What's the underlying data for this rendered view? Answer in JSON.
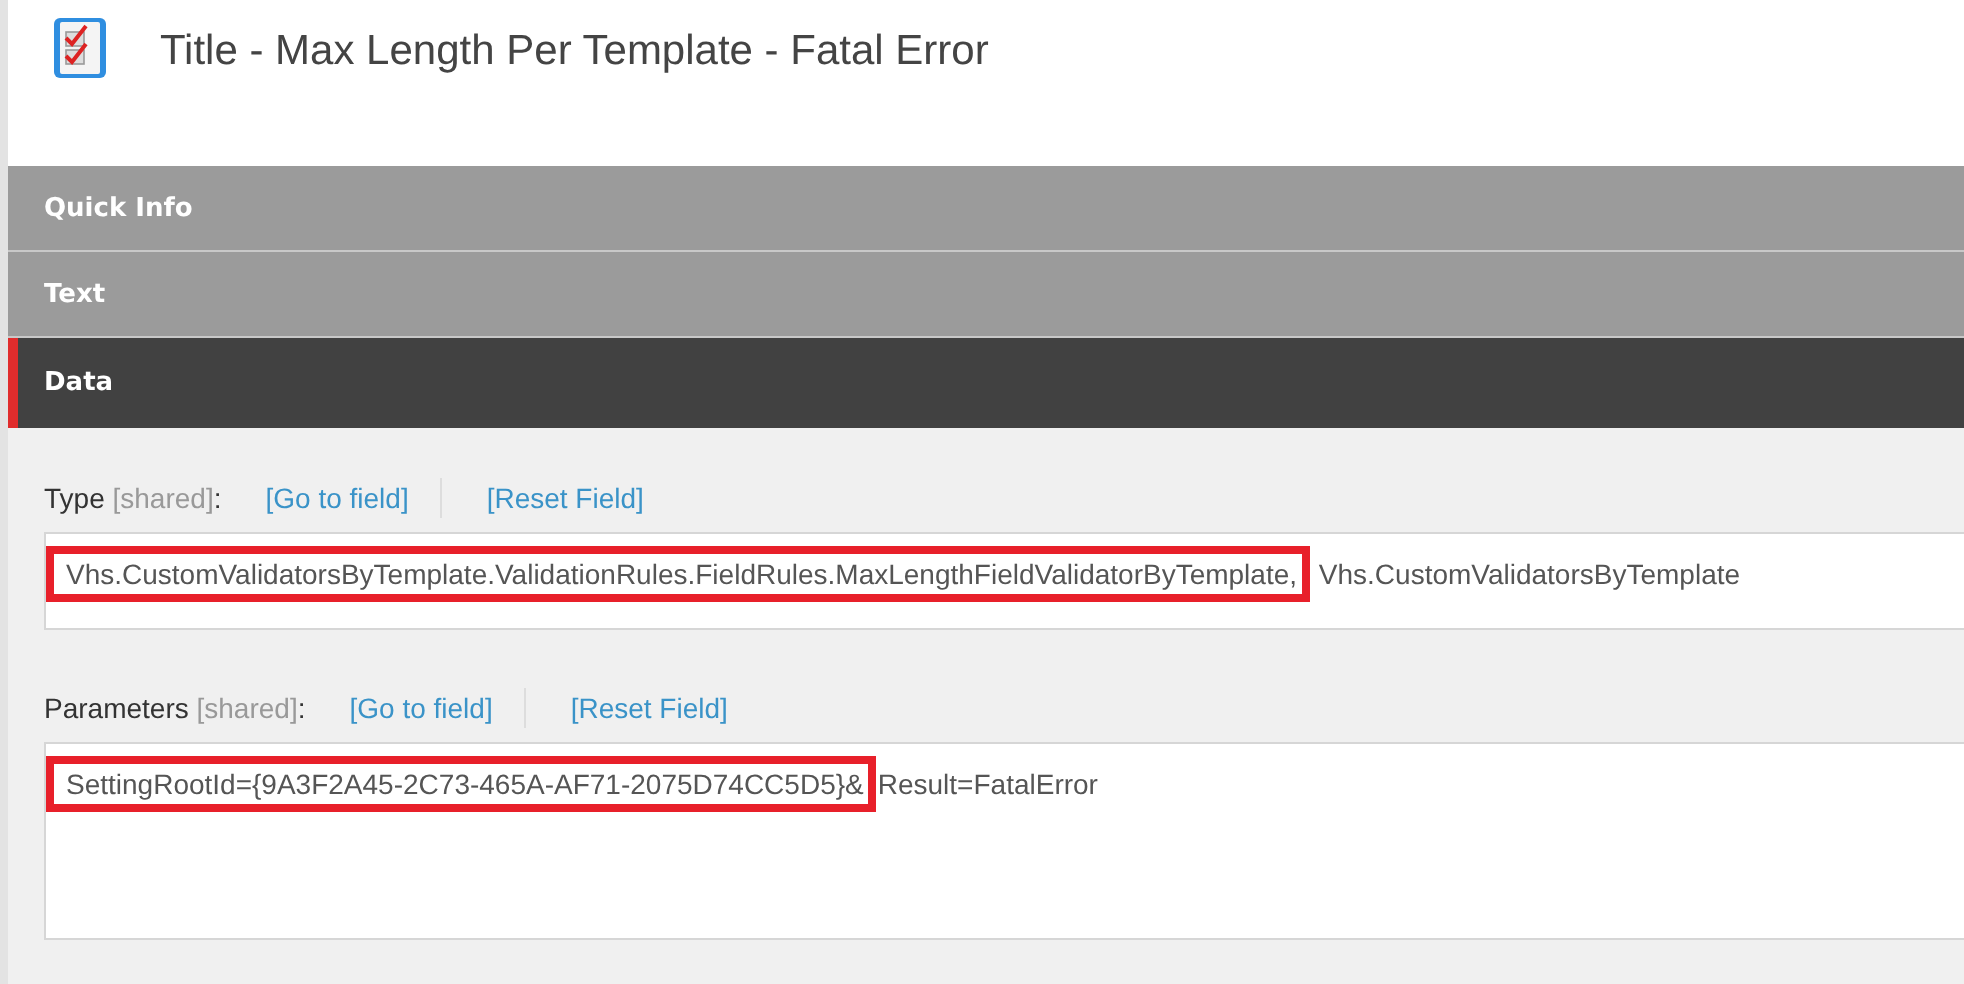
{
  "header": {
    "title": "Title - Max Length Per Template - Fatal Error"
  },
  "sections": [
    {
      "label": "Quick Info",
      "expanded": false
    },
    {
      "label": "Text",
      "expanded": false
    },
    {
      "label": "Data",
      "expanded": true
    }
  ],
  "fields": [
    {
      "kind": "line",
      "label": "Type",
      "shared": "[shared]",
      "colon": ":",
      "links": [
        "[Go to field]",
        "[Reset Field]"
      ],
      "value": {
        "highlighted": "Vhs.CustomValidatorsByTemplate.ValidationRules.FieldRules.MaxLengthFieldValidatorByTemplate,",
        "rest": " Vhs.CustomValidatorsByTemplate"
      }
    },
    {
      "kind": "multiline",
      "label": "Parameters",
      "shared": "[shared]",
      "colon": ":",
      "links": [
        "[Go to field]",
        "[Reset Field]"
      ],
      "value": {
        "highlighted": "SettingRootId={9A3F2A45-2C73-465A-AF71-2075D74CC5D5}&",
        "rest": "Result=FatalError"
      }
    }
  ]
}
